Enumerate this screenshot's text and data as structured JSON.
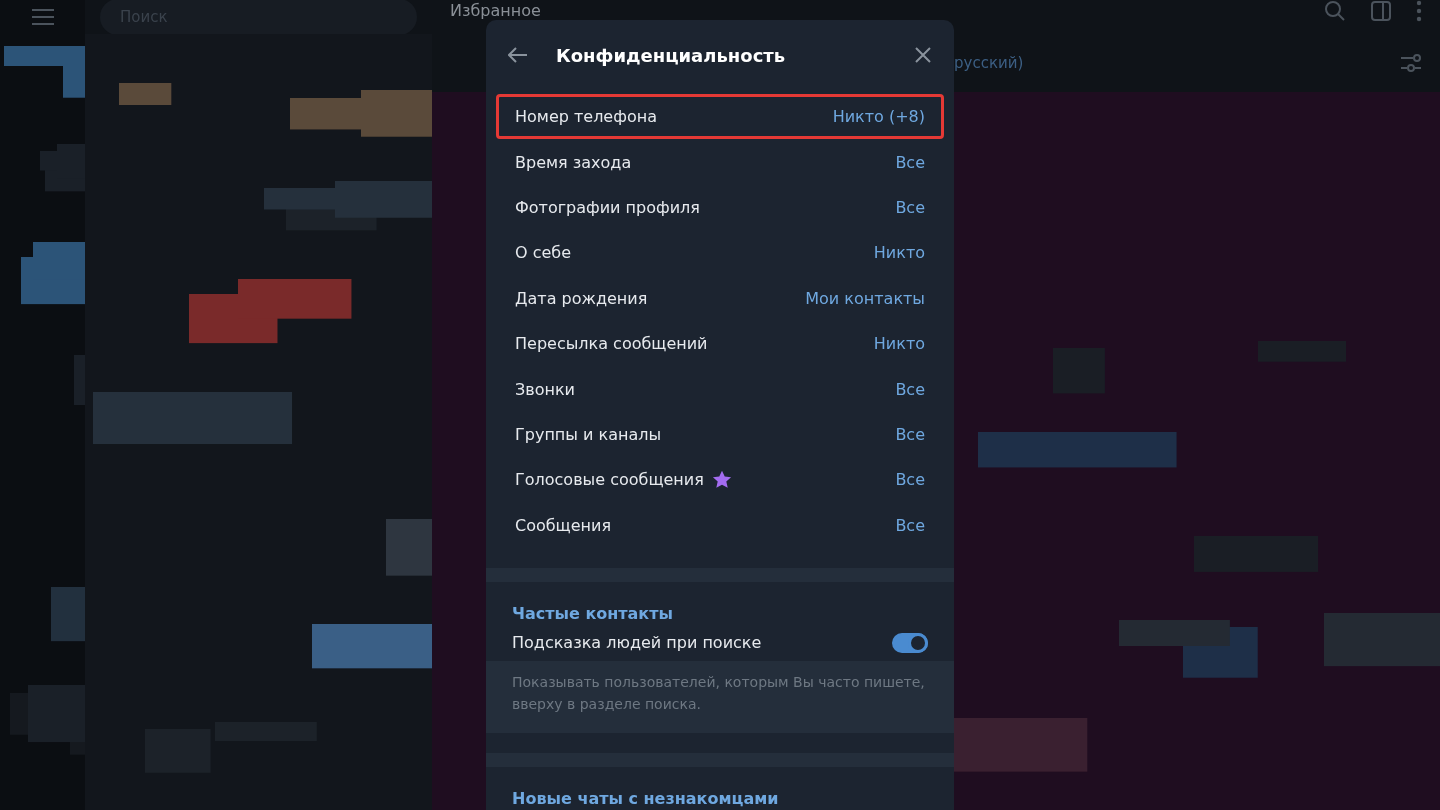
{
  "sidebar": {
    "search": {
      "placeholder": "Поиск"
    }
  },
  "chat": {
    "title": "Избранное",
    "pinned_snippet": "русский)"
  },
  "dialog": {
    "title": "Конфиденциальность",
    "privacy_items": [
      {
        "label": "Номер телефона",
        "value": "Никто (+8)",
        "highlighted": true,
        "premium": false
      },
      {
        "label": "Время захода",
        "value": "Все",
        "highlighted": false,
        "premium": false
      },
      {
        "label": "Фотографии профиля",
        "value": "Все",
        "highlighted": false,
        "premium": false
      },
      {
        "label": "О себе",
        "value": "Никто",
        "highlighted": false,
        "premium": false
      },
      {
        "label": "Дата рождения",
        "value": "Мои контакты",
        "highlighted": false,
        "premium": false
      },
      {
        "label": "Пересылка сообщений",
        "value": "Никто",
        "highlighted": false,
        "premium": false
      },
      {
        "label": "Звонки",
        "value": "Все",
        "highlighted": false,
        "premium": false
      },
      {
        "label": "Группы и каналы",
        "value": "Все",
        "highlighted": false,
        "premium": false
      },
      {
        "label": "Голосовые сообщения",
        "value": "Все",
        "highlighted": false,
        "premium": true
      },
      {
        "label": "Сообщения",
        "value": "Все",
        "highlighted": false,
        "premium": false
      }
    ],
    "sections": [
      {
        "heading": "Частые контакты",
        "toggle": {
          "label": "Подсказка людей при поиске",
          "on": true
        },
        "hint": "Показывать пользователей, которым Вы часто пишете, вверху в разделе поиска."
      },
      {
        "heading": "Новые чаты с незнакомцами"
      }
    ]
  }
}
